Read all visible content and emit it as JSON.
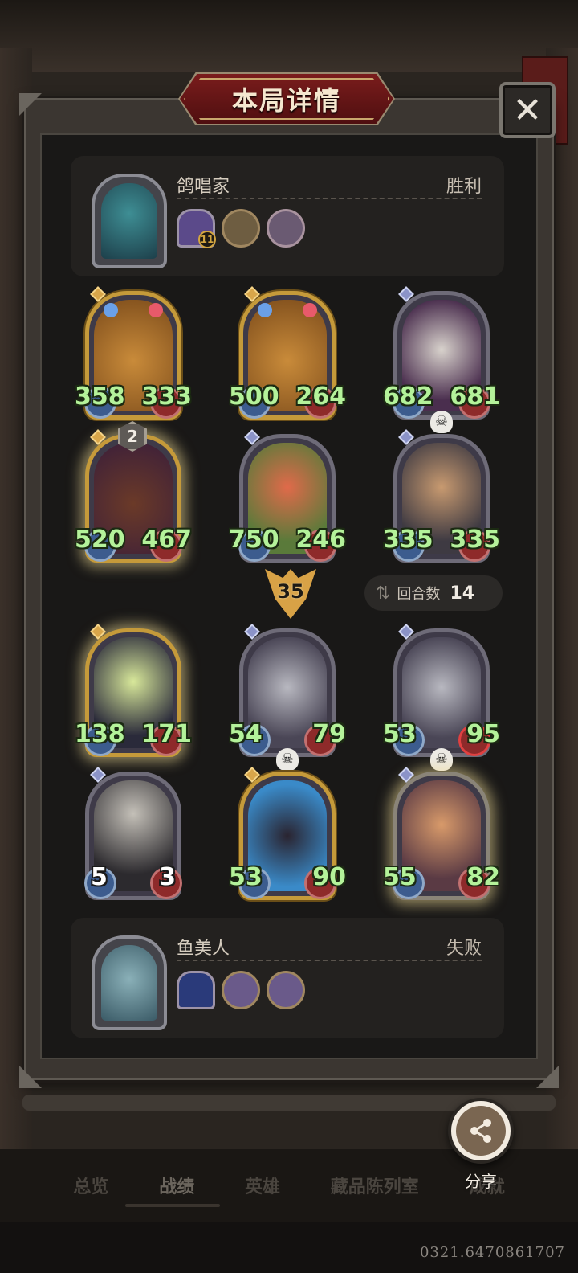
{
  "header": {
    "title": "本局详情",
    "close_symbol": "✕"
  },
  "winner": {
    "name": "鸽唱家",
    "result": "胜利",
    "trinket_level": "11"
  },
  "loser": {
    "name": "鱼美人",
    "result": "失败"
  },
  "winner_board": [
    {
      "attack": "358",
      "health": "333"
    },
    {
      "attack": "500",
      "health": "264"
    },
    {
      "attack": "682",
      "health": "681"
    },
    {
      "attack": "520",
      "health": "467",
      "level": "2"
    },
    {
      "attack": "750",
      "health": "246"
    },
    {
      "attack": "335",
      "health": "335"
    }
  ],
  "damage": "35",
  "round": {
    "label": "回合数",
    "value": "14"
  },
  "loser_board": [
    {
      "attack": "138",
      "health": "171"
    },
    {
      "attack": "54",
      "health": "79"
    },
    {
      "attack": "53",
      "health": "95"
    },
    {
      "attack": "5",
      "health": "3"
    },
    {
      "attack": "53",
      "health": "90"
    },
    {
      "attack": "55",
      "health": "82"
    }
  ],
  "nav": {
    "tabs": [
      "总览",
      "战绩",
      "英雄",
      "藏品陈列室",
      "成就"
    ],
    "active_index": 1
  },
  "share": {
    "label": "分享"
  },
  "footer": {
    "id_text": "0321.6470861707"
  },
  "colors": {
    "stat_green": "#b4f29a",
    "title_red": "#7a1c1c",
    "gold_border": "#c59a3a"
  }
}
